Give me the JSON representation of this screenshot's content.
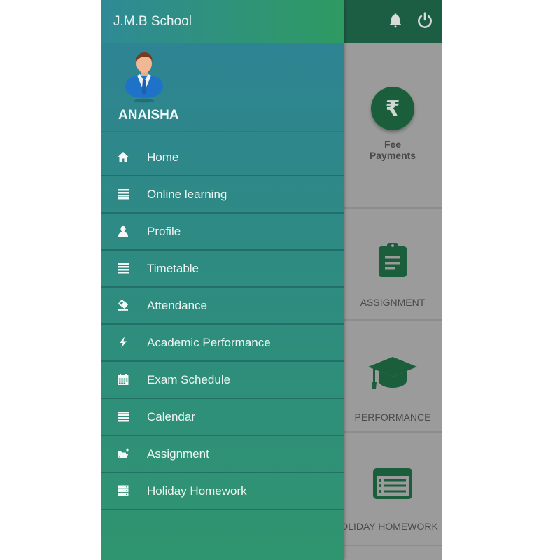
{
  "app": {
    "school_name": "J.M.B School",
    "student_name": "ANAISHA"
  },
  "header_actions": [
    {
      "name": "notifications",
      "icon": "bell-icon"
    },
    {
      "name": "logout",
      "icon": "power-icon"
    }
  ],
  "menu": {
    "items": [
      {
        "label": "Home",
        "icon": "home-icon"
      },
      {
        "label": "Online learning",
        "icon": "list-icon"
      },
      {
        "label": "Profile",
        "icon": "user-icon"
      },
      {
        "label": "Timetable",
        "icon": "list-icon"
      },
      {
        "label": "Attendance",
        "icon": "eraser-icon"
      },
      {
        "label": "Academic Performance",
        "icon": "bolt-icon"
      },
      {
        "label": "Exam Schedule",
        "icon": "calendar-icon"
      },
      {
        "label": "Calendar",
        "icon": "list-icon"
      },
      {
        "label": "Assignment",
        "icon": "folder-icon"
      },
      {
        "label": "Holiday Homework",
        "icon": "server-icon"
      }
    ]
  },
  "tiles": [
    {
      "label_line1": "Fee",
      "label_line2": "Payments",
      "icon": "rupee-icon",
      "symbol": "₹"
    },
    {
      "label": "ASSIGNMENT",
      "icon": "clipboard-icon"
    },
    {
      "label": "PERFORMANCE",
      "icon": "graduation-cap-icon"
    },
    {
      "label": "HOLIDAY HOMEWORK",
      "icon": "list-window-icon"
    }
  ],
  "colors": {
    "app_bar": "#1c5e44",
    "drawer_top": "#2e8296",
    "drawer_bottom": "#2f946f",
    "tile_icon": "#1b5e3b",
    "scrim": "#9b9b9b"
  }
}
